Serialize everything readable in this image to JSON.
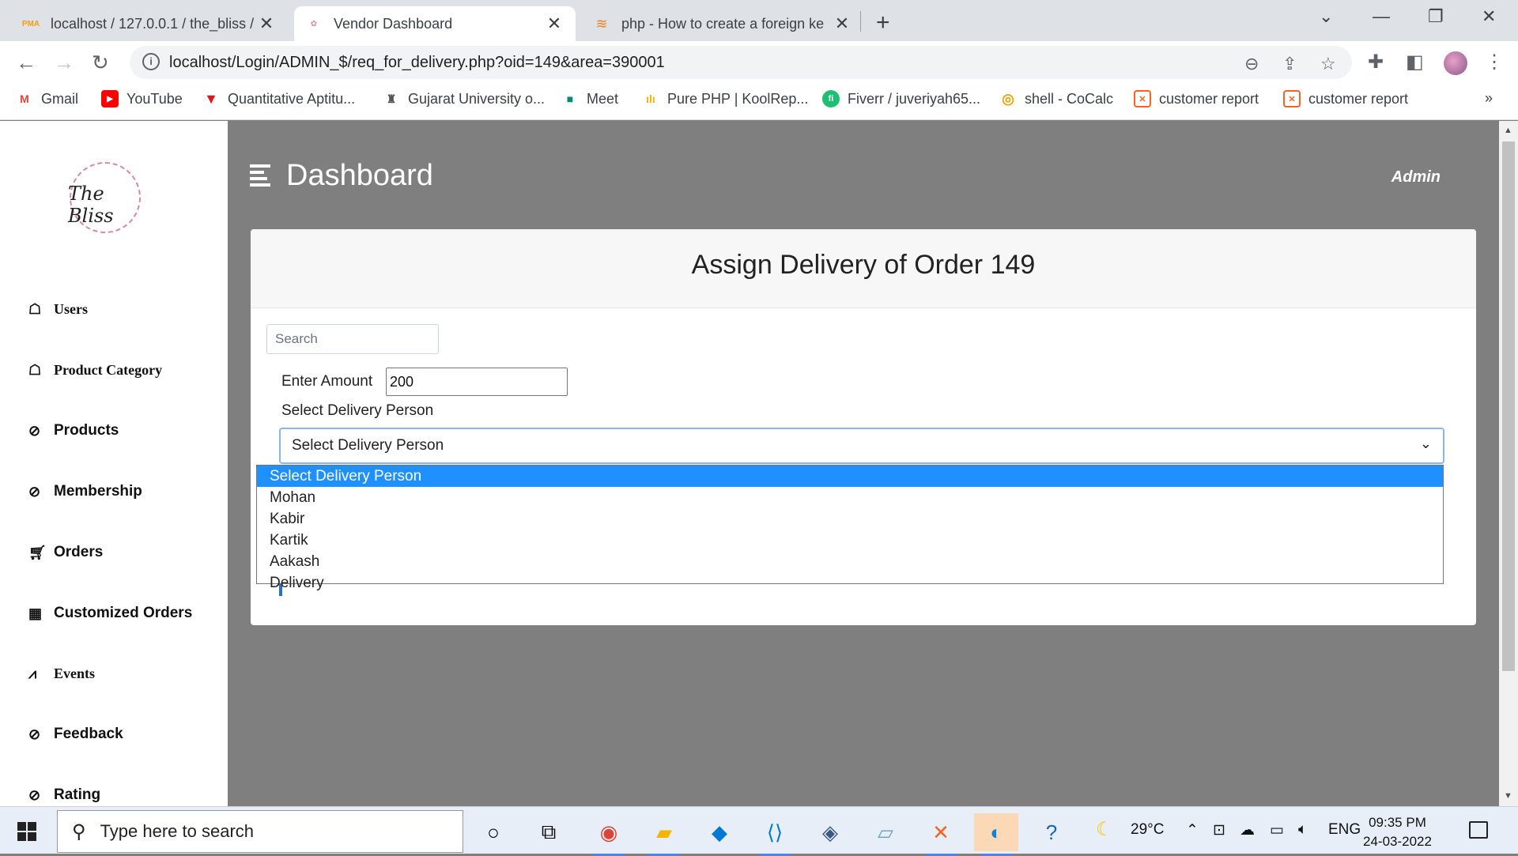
{
  "browser": {
    "tabs": [
      {
        "title": "localhost / 127.0.0.1 / the_bliss / ",
        "favicon": "PMA"
      },
      {
        "title": "Vendor Dashboard",
        "favicon": "The Bliss"
      },
      {
        "title": "php - How to create a foreign ke",
        "favicon": "stackoverflow-icon"
      }
    ],
    "url": "localhost/Login/ADMIN_$/req_for_delivery.php?oid=149&area=390001",
    "bookmarks": [
      {
        "label": "Gmail",
        "icon": "M",
        "color": "#ea4335"
      },
      {
        "label": "YouTube",
        "icon": "▶",
        "color": "#ff0000"
      },
      {
        "label": "Quantitative Aptitu...",
        "icon": "▼",
        "color": "#e0171f"
      },
      {
        "label": "Gujarat University o...",
        "icon": "♜",
        "color": "#555555"
      },
      {
        "label": "Meet",
        "icon": "■",
        "color": "#00897b"
      },
      {
        "label": "Pure PHP | KoolRep...",
        "icon": "ılı",
        "color": "#f4b400"
      },
      {
        "label": "Fiverr / juveriyah65...",
        "icon": "fi",
        "color": "#1dbf73"
      },
      {
        "label": "shell - CoCalc",
        "icon": "◎",
        "color": "#f4a000"
      },
      {
        "label": "customer report",
        "icon": "✕",
        "color": "#f26522"
      },
      {
        "label": "customer report",
        "icon": "✕",
        "color": "#f26522"
      }
    ],
    "more_bookmarks": "»"
  },
  "sidebar": {
    "logo_text": "The Bliss",
    "items": [
      {
        "label": "Users",
        "icon": "sitemap-icon"
      },
      {
        "label": "Product Category",
        "icon": "sitemap-icon"
      },
      {
        "label": "Products",
        "icon": "paperclip-icon"
      },
      {
        "label": "Membership",
        "icon": "paperclip-icon"
      },
      {
        "label": "Orders",
        "icon": "cart-icon"
      },
      {
        "label": "Customized Orders",
        "icon": "gift-icon"
      },
      {
        "label": "Events",
        "icon": "chart-icon"
      },
      {
        "label": "Feedback",
        "icon": "paperclip-icon"
      },
      {
        "label": "Rating",
        "icon": "paperclip-icon"
      }
    ]
  },
  "header": {
    "title": "Dashboard",
    "user": "Admin"
  },
  "card": {
    "title": "Assign Delivery of Order 149",
    "search_placeholder": "Search",
    "amount_label": "Enter Amount",
    "amount_value": "200",
    "delivery_label": "Select Delivery Person",
    "select_value": "Select Delivery Person",
    "options": [
      "Select Delivery Person",
      "Mohan",
      "Kabir",
      "Kartik",
      "Aakash",
      "Delivery"
    ],
    "selected_option_index": 0
  },
  "taskbar": {
    "search_placeholder": "Type here to search",
    "weather": "29°C",
    "language": "ENG",
    "time": "09:35 PM",
    "date": "24-03-2022"
  }
}
